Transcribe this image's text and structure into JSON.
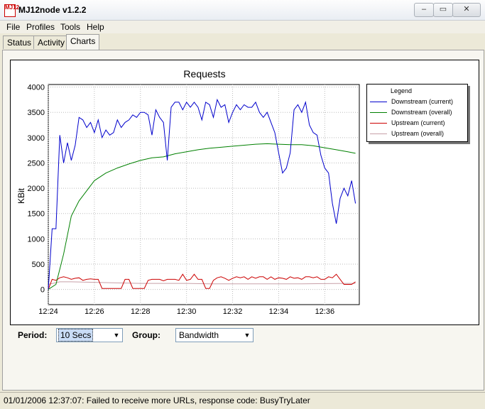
{
  "window": {
    "title": "MJ12node v1.2.2",
    "icon_text": "MJ12",
    "controls": [
      "minimize-icon",
      "maximize-icon",
      "close-icon"
    ]
  },
  "menu": [
    "File",
    "Profiles",
    "Tools",
    "Help"
  ],
  "tabs": [
    {
      "label": "Status",
      "active": false
    },
    {
      "label": "Activity",
      "active": false
    },
    {
      "label": "Charts",
      "active": true
    }
  ],
  "controls": {
    "period_label": "Period:",
    "period_value": "10 Secs",
    "group_label": "Group:",
    "group_value": "Bandwidth"
  },
  "status_bar": {
    "text": "01/01/2006 12:37:07: Failed to receive more URLs, response code: BusyTryLater"
  },
  "chart_data": {
    "type": "line",
    "title": "Requests",
    "xlabel": "",
    "ylabel": "KBit",
    "ylim": [
      -300,
      4050
    ],
    "yticks": [
      0,
      500,
      1000,
      1500,
      2000,
      2500,
      3000,
      3500,
      4000
    ],
    "x_range": [
      "12:24",
      "12:37:30"
    ],
    "xticks": [
      "12:24",
      "12:26",
      "12:28",
      "12:30",
      "12:32",
      "12:34",
      "12:36"
    ],
    "grid": true,
    "legend_title": "Legend",
    "legend_position": "right",
    "series": [
      {
        "name": "Downstream (current)",
        "color": "#0000cc",
        "x": [
          "12:24:00",
          "12:24:10",
          "12:24:20",
          "12:24:30",
          "12:24:40",
          "12:24:50",
          "12:25:00",
          "12:25:10",
          "12:25:20",
          "12:25:30",
          "12:25:40",
          "12:25:50",
          "12:26:00",
          "12:26:10",
          "12:26:20",
          "12:26:30",
          "12:26:40",
          "12:26:50",
          "12:27:00",
          "12:27:10",
          "12:27:20",
          "12:27:30",
          "12:27:40",
          "12:27:50",
          "12:28:00",
          "12:28:10",
          "12:28:20",
          "12:28:30",
          "12:28:40",
          "12:28:50",
          "12:29:00",
          "12:29:10",
          "12:29:20",
          "12:29:30",
          "12:29:40",
          "12:29:50",
          "12:30:00",
          "12:30:10",
          "12:30:20",
          "12:30:30",
          "12:30:40",
          "12:30:50",
          "12:31:00",
          "12:31:10",
          "12:31:20",
          "12:31:30",
          "12:31:40",
          "12:31:50",
          "12:32:00",
          "12:32:10",
          "12:32:20",
          "12:32:30",
          "12:32:40",
          "12:32:50",
          "12:33:00",
          "12:33:10",
          "12:33:20",
          "12:33:30",
          "12:33:40",
          "12:33:50",
          "12:34:00",
          "12:34:10",
          "12:34:20",
          "12:34:30",
          "12:34:40",
          "12:34:50",
          "12:35:00",
          "12:35:10",
          "12:35:20",
          "12:35:30",
          "12:35:40",
          "12:35:50",
          "12:36:00",
          "12:36:10",
          "12:36:20",
          "12:36:30",
          "12:36:40",
          "12:36:50",
          "12:37:00",
          "12:37:10",
          "12:37:20"
        ],
        "values": [
          0,
          1200,
          1200,
          3050,
          2500,
          2900,
          2550,
          2850,
          3400,
          3350,
          3200,
          3300,
          3100,
          3350,
          3000,
          3150,
          3050,
          3100,
          3350,
          3200,
          3300,
          3350,
          3450,
          3400,
          3500,
          3500,
          3450,
          3050,
          3550,
          3400,
          3300,
          2550,
          3600,
          3700,
          3700,
          3550,
          3700,
          3600,
          3700,
          3600,
          3350,
          3700,
          3650,
          3400,
          3750,
          3600,
          3650,
          3300,
          3500,
          3650,
          3550,
          3650,
          3600,
          3600,
          3700,
          3500,
          3400,
          3500,
          3300,
          3100,
          2700,
          2300,
          2400,
          2700,
          3550,
          3650,
          3500,
          3700,
          3250,
          3100,
          3050,
          2650,
          2400,
          2300,
          1700,
          1300,
          1800,
          2000,
          1850,
          2150,
          1700
        ]
      },
      {
        "name": "Downstream (overall)",
        "color": "#008000",
        "x": [
          "12:24:00",
          "12:24:20",
          "12:24:40",
          "12:25:00",
          "12:25:20",
          "12:25:40",
          "12:26:00",
          "12:26:30",
          "12:27:00",
          "12:27:30",
          "12:28:00",
          "12:28:30",
          "12:29:00",
          "12:29:30",
          "12:30:00",
          "12:30:30",
          "12:31:00",
          "12:31:30",
          "12:32:00",
          "12:32:30",
          "12:33:00",
          "12:33:30",
          "12:34:00",
          "12:34:30",
          "12:35:00",
          "12:35:30",
          "12:36:00",
          "12:36:30",
          "12:37:00",
          "12:37:20"
        ],
        "values": [
          0,
          100,
          700,
          1450,
          1750,
          1950,
          2150,
          2300,
          2400,
          2480,
          2550,
          2600,
          2620,
          2680,
          2720,
          2760,
          2790,
          2810,
          2830,
          2850,
          2870,
          2880,
          2870,
          2860,
          2860,
          2840,
          2800,
          2760,
          2720,
          2690
        ]
      },
      {
        "name": "Upstream (current)",
        "color": "#cc0000",
        "x": [
          "12:24:00",
          "12:24:10",
          "12:24:20",
          "12:24:30",
          "12:24:40",
          "12:24:50",
          "12:25:00",
          "12:25:10",
          "12:25:20",
          "12:25:30",
          "12:25:40",
          "12:25:50",
          "12:26:00",
          "12:26:10",
          "12:26:20",
          "12:26:30",
          "12:26:40",
          "12:26:50",
          "12:27:00",
          "12:27:10",
          "12:27:20",
          "12:27:30",
          "12:27:40",
          "12:27:50",
          "12:28:00",
          "12:28:10",
          "12:28:20",
          "12:28:30",
          "12:28:40",
          "12:28:50",
          "12:29:00",
          "12:29:10",
          "12:29:20",
          "12:29:30",
          "12:29:40",
          "12:29:50",
          "12:30:00",
          "12:30:10",
          "12:30:20",
          "12:30:30",
          "12:30:40",
          "12:30:50",
          "12:31:00",
          "12:31:10",
          "12:31:20",
          "12:31:30",
          "12:31:40",
          "12:31:50",
          "12:32:00",
          "12:32:10",
          "12:32:20",
          "12:32:30",
          "12:32:40",
          "12:32:50",
          "12:33:00",
          "12:33:10",
          "12:33:20",
          "12:33:30",
          "12:33:40",
          "12:33:50",
          "12:34:00",
          "12:34:10",
          "12:34:20",
          "12:34:30",
          "12:34:40",
          "12:34:50",
          "12:35:00",
          "12:35:10",
          "12:35:20",
          "12:35:30",
          "12:35:40",
          "12:35:50",
          "12:36:00",
          "12:36:10",
          "12:36:20",
          "12:36:30",
          "12:36:40",
          "12:36:50",
          "12:37:00",
          "12:37:10",
          "12:37:20"
        ],
        "values": [
          0,
          200,
          180,
          230,
          250,
          230,
          200,
          220,
          230,
          180,
          200,
          210,
          200,
          200,
          20,
          20,
          20,
          20,
          20,
          20,
          200,
          200,
          20,
          20,
          20,
          20,
          180,
          200,
          200,
          200,
          170,
          200,
          200,
          200,
          180,
          300,
          180,
          200,
          300,
          200,
          200,
          20,
          20,
          180,
          230,
          250,
          220,
          180,
          220,
          250,
          230,
          250,
          200,
          250,
          220,
          250,
          250,
          200,
          250,
          200,
          230,
          220,
          200,
          250,
          220,
          230,
          200,
          250,
          250,
          230,
          250,
          200,
          200,
          250,
          230,
          300,
          200,
          100,
          100,
          100,
          150
        ]
      },
      {
        "name": "Upstream (overall)",
        "color": "#c8a0a8",
        "x": [
          "12:24:00",
          "12:24:30",
          "12:25:00",
          "12:26:00",
          "12:27:00",
          "12:28:00",
          "12:29:00",
          "12:30:00",
          "12:31:00",
          "12:32:00",
          "12:33:00",
          "12:34:00",
          "12:35:00",
          "12:36:00",
          "12:37:00",
          "12:37:20"
        ],
        "values": [
          100,
          150,
          150,
          140,
          130,
          120,
          120,
          120,
          110,
          110,
          110,
          110,
          110,
          115,
          120,
          120
        ]
      }
    ]
  }
}
